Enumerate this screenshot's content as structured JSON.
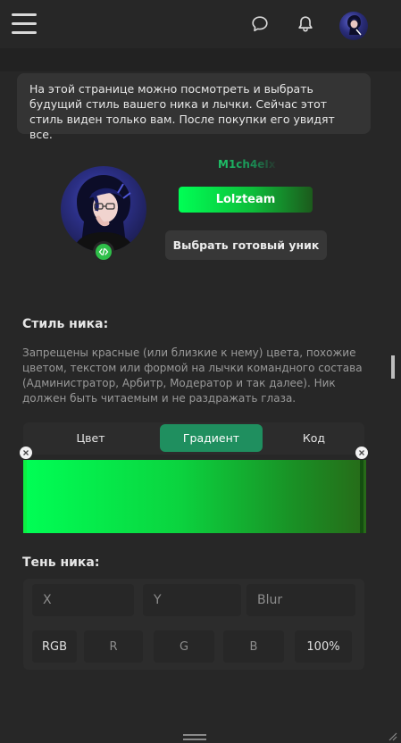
{
  "header": {
    "menu_icon": "hamburger-menu-icon",
    "chat_icon": "chat-bubble-icon",
    "notifications_icon": "bell-icon"
  },
  "info": {
    "text": "На этой странице можно посмотреть и выбрать будущий стиль вашего ника и лычки. Сейчас этот стиль виден только вам. После покупки его увидят все."
  },
  "profile": {
    "nickname": "M1ch4eIx",
    "banner": "Lolzteam",
    "choose_button": "Выбрать готовый уник",
    "badge_icon": "code-brackets-icon"
  },
  "nick_style": {
    "title": "Стиль ника:",
    "description": "Запрещены красные (или близкие к нему) цвета, похожие цветом, текстом или формой на лычки командного состава (Администратор, Арбитр, Модератор и так далее). Ник должен быть читаемым и не раздражать глаза.",
    "tabs": [
      "Цвет",
      "Градиент",
      "Код"
    ],
    "active_tab": "Градиент",
    "gradient_start": "#00ff55",
    "gradient_end": "#276a18"
  },
  "shadow": {
    "title": "Тень ника:",
    "x_placeholder": "X",
    "y_placeholder": "Y",
    "blur_placeholder": "Blur",
    "mode": "RGB",
    "r_placeholder": "R",
    "g_placeholder": "G",
    "b_placeholder": "B",
    "alpha": "100%"
  },
  "colors": {
    "background": "#272727",
    "accent": "#1f8f5f",
    "panel": "#343434"
  }
}
